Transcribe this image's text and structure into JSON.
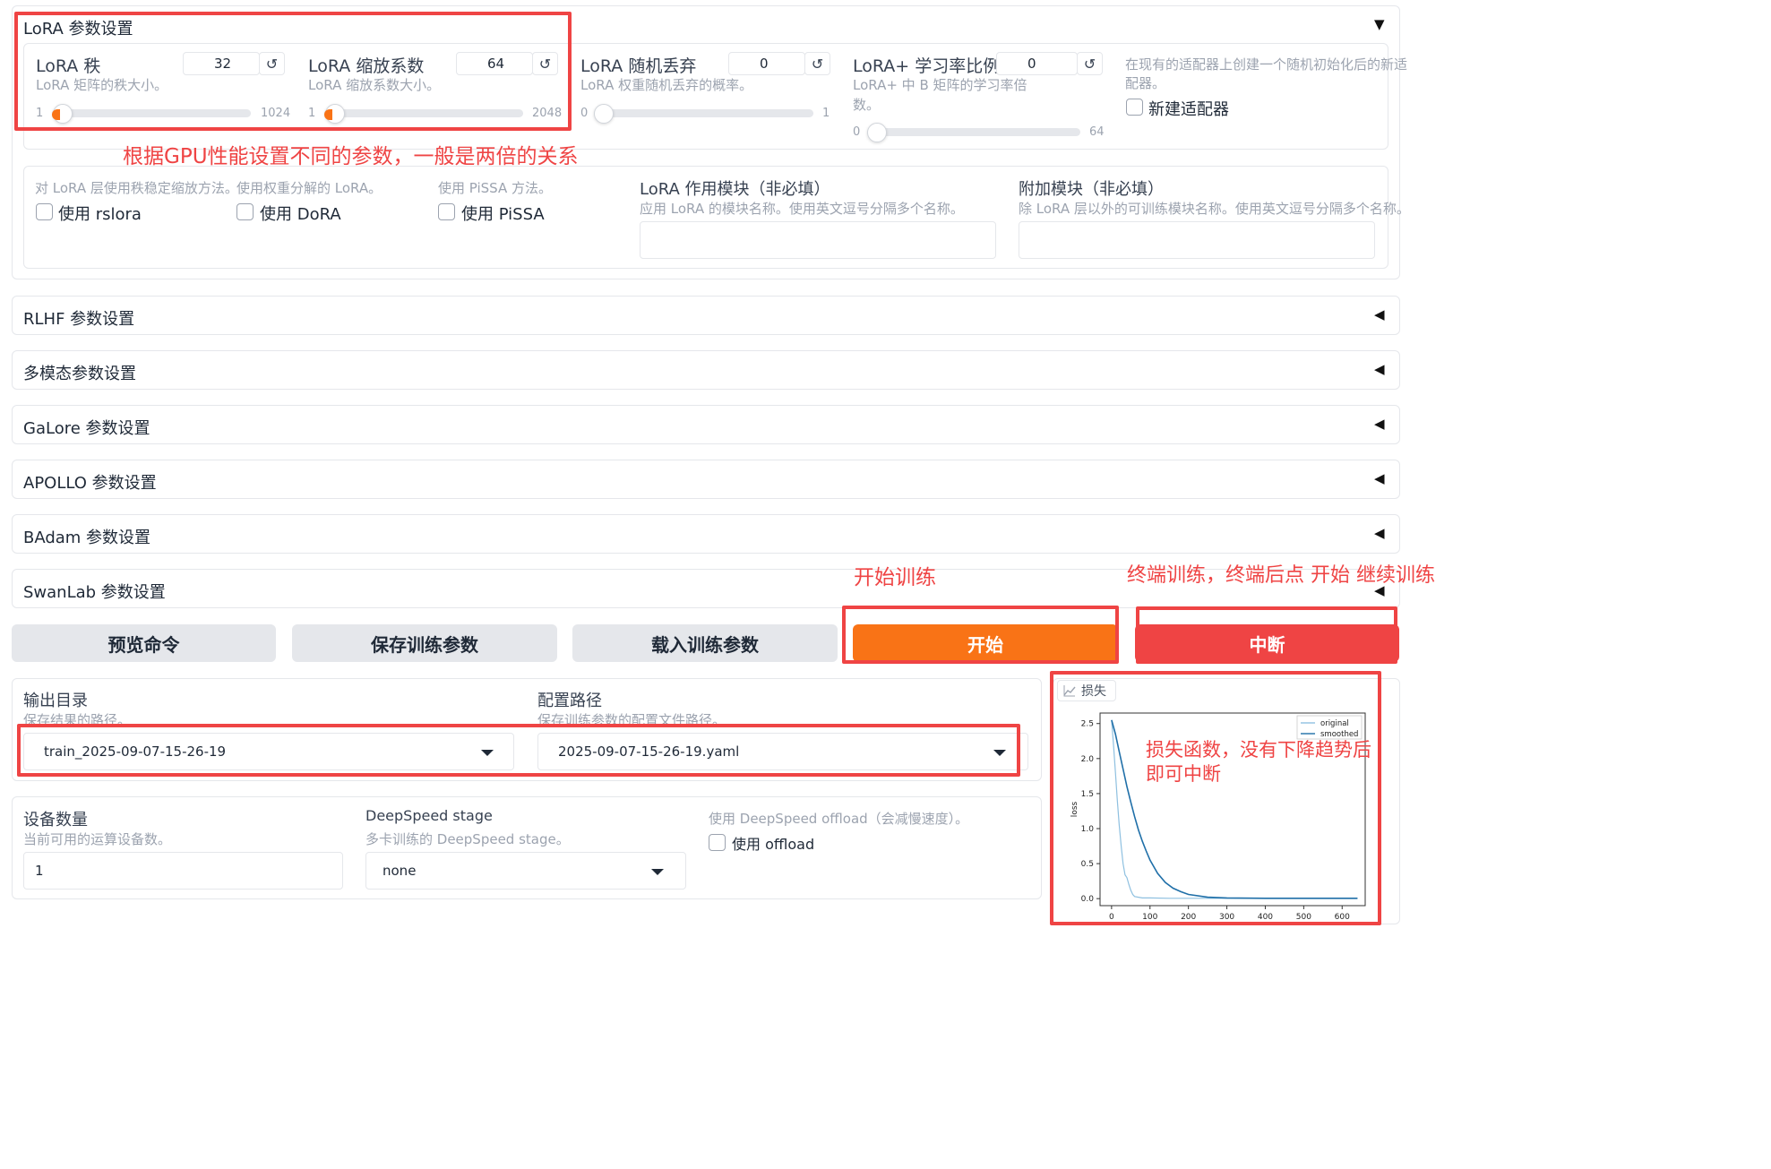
{
  "lora": {
    "title": "LoRA 参数设置",
    "collapse_arrow": "▼",
    "rank": {
      "label": "LoRA 秩",
      "info": "LoRA 矩阵的秩大小。",
      "value": "32",
      "min": "1",
      "max": "1024",
      "level": 32
    },
    "alpha": {
      "label": "LoRA 缩放系数",
      "info": "LoRA 缩放系数大小。",
      "value": "64",
      "min": "1",
      "max": "2048",
      "level": 64
    },
    "dropout": {
      "label": "LoRA 随机丢弃",
      "info": "LoRA 权重随机丢弃的概率。",
      "value": "0",
      "min": "0",
      "max": "1",
      "level": 0
    },
    "plus_ratio": {
      "label": "LoRA+ 学习率比例",
      "info_line1": "LoRA+ 中 B 矩阵的学习率倍",
      "info_line2": "数。",
      "value": "0",
      "min": "0",
      "max": "64",
      "level": 0
    },
    "create_new": {
      "info_line1": "在现有的适配器上创建一个随机初始化后的新适",
      "info_line2": "配器。",
      "label": "新建适配器"
    },
    "rslora": {
      "info": "对 LoRA 层使用秩稳定缩放方法。",
      "label": "使用 rslora"
    },
    "dora": {
      "info": "使用权重分解的 LoRA。",
      "label": "使用 DoRA"
    },
    "pissa": {
      "info": "使用 PiSSA 方法。",
      "label": "使用 PiSSA"
    },
    "target": {
      "label": "LoRA 作用模块（非必填）",
      "info": "应用 LoRA 的模块名称。使用英文逗号分隔多个名称。"
    },
    "additional": {
      "label": "附加模块（非必填）",
      "info": "除 LoRA 层以外的可训练模块名称。使用英文逗号分隔多个名称。"
    }
  },
  "accordions": [
    {
      "title": "RLHF 参数设置",
      "arrow": "◀"
    },
    {
      "title": "多模态参数设置",
      "arrow": "◀"
    },
    {
      "title": "GaLore 参数设置",
      "arrow": "◀"
    },
    {
      "title": "APOLLO 参数设置",
      "arrow": "◀"
    },
    {
      "title": "BAdam 参数设置",
      "arrow": "◀"
    },
    {
      "title": "SwanLab 参数设置",
      "arrow": "◀"
    }
  ],
  "reset_icon": "↺",
  "buttons": {
    "preview": "预览命令",
    "save": "保存训练参数",
    "load": "载入训练参数",
    "start": "开始",
    "stop": "中断"
  },
  "output": {
    "dir_label": "输出目录",
    "dir_info": "保存结果的路径。",
    "dir_value": "train_2025-09-07-15-26-19",
    "config_label": "配置路径",
    "config_info": "保存训练参数的配置文件路径。",
    "config_value": "2025-09-07-15-26-19.yaml"
  },
  "device": {
    "count_label": "设备数量",
    "count_info": "当前可用的运算设备数。",
    "count_value": "1",
    "ds_label": "DeepSpeed stage",
    "ds_info": "多卡训练的 DeepSpeed stage。",
    "ds_value": "none",
    "offload_info": "使用 DeepSpeed offload（会减慢速度）。",
    "offload_label": "使用 offload"
  },
  "loss_tab": {
    "icon": "chart-icon",
    "label": "损失"
  },
  "annotations": {
    "params": "根据GPU性能设置不同的参数，一般是两倍的关系",
    "start": "开始训练",
    "stop": "终端训练，终端后点 开始 继续训练",
    "loss_line1": "损失函数，没有下降趋势后",
    "loss_line2": "即可中断"
  },
  "colors": {
    "accent": "#f97316",
    "stop": "#ef4444",
    "annotation": "#ef4444",
    "original": "#8ec0e0",
    "smoothed": "#1f6fa8"
  },
  "chart_data": {
    "type": "line",
    "xlabel": "",
    "ylabel": "loss",
    "xlim": [
      -30,
      660
    ],
    "ylim": [
      -0.1,
      2.65
    ],
    "x_ticks": [
      0,
      100,
      200,
      300,
      400,
      500,
      600
    ],
    "y_ticks": [
      "0.0",
      "0.5",
      "1.0",
      "1.5",
      "2.0",
      "2.5"
    ],
    "legend_position": "top-right",
    "series": [
      {
        "name": "original",
        "color": "#8ec0e0",
        "x": [
          0,
          5,
          10,
          15,
          20,
          25,
          30,
          35,
          40,
          45,
          50,
          55,
          60,
          70,
          80,
          100,
          150,
          200,
          300,
          400,
          500,
          600,
          640
        ],
        "y": [
          2.55,
          2.2,
          1.8,
          1.4,
          1.05,
          0.75,
          0.5,
          0.34,
          0.3,
          0.2,
          0.12,
          0.06,
          0.03,
          0.02,
          0.01,
          0.01,
          0.005,
          0.005,
          0.005,
          0.005,
          0.005,
          0.005,
          0.005
        ]
      },
      {
        "name": "smoothed",
        "color": "#1f6fa8",
        "x": [
          0,
          10,
          20,
          30,
          40,
          50,
          60,
          70,
          80,
          90,
          100,
          120,
          140,
          160,
          180,
          200,
          250,
          300,
          400,
          500,
          600,
          640
        ],
        "y": [
          2.55,
          2.35,
          2.1,
          1.85,
          1.6,
          1.38,
          1.17,
          0.98,
          0.82,
          0.68,
          0.55,
          0.36,
          0.23,
          0.15,
          0.1,
          0.06,
          0.02,
          0.01,
          0.005,
          0.005,
          0.005,
          0.005
        ]
      }
    ]
  }
}
